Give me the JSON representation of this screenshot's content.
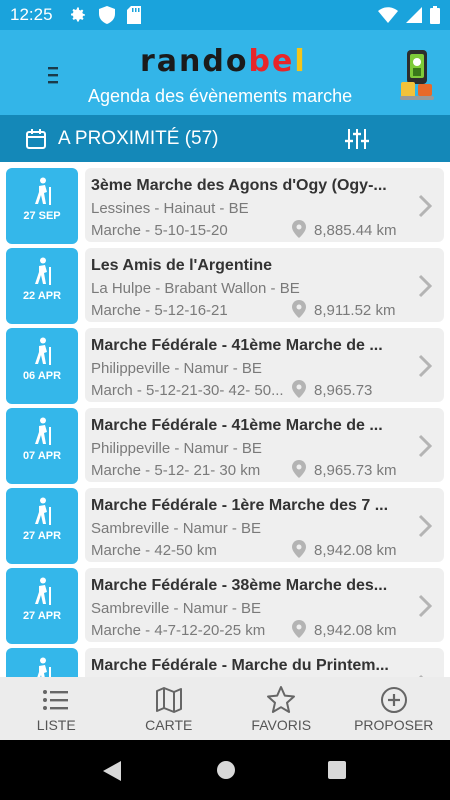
{
  "status_bar": {
    "time": "12:25"
  },
  "header": {
    "logo": {
      "part1": "rando",
      "part2": "be",
      "part3": "l"
    },
    "subtitle": "Agenda des évènements marche"
  },
  "nearby": {
    "title": "A PROXIMITÉ (57)"
  },
  "events": [
    {
      "day": "27 SEP",
      "title": "3ème Marche des Agons d'Ogy (Ogy-...",
      "location": "Lessines - Hainaut - BE",
      "distances": "Marche - 5-10-15-20",
      "km": "8,885.44 km"
    },
    {
      "day": "22 APR",
      "title": "Les Amis de l'Argentine",
      "location": "La Hulpe - Brabant Wallon - BE",
      "distances": "Marche - 5-12-16-21",
      "km": "8,911.52 km"
    },
    {
      "day": "06 APR",
      "title": "Marche Fédérale - 41ème Marche de ...",
      "location": "Philippeville - Namur - BE",
      "distances": "March  - 5-12-21-30- 42- 50...",
      "km": "8,965.73"
    },
    {
      "day": "07 APR",
      "title": "Marche Fédérale - 41ème Marche de ...",
      "location": "Philippeville - Namur - BE",
      "distances": "Marche - 5-12- 21- 30 km",
      "km": "8,965.73 km"
    },
    {
      "day": "27 APR",
      "title": "Marche Fédérale - 1ère Marche des 7 ...",
      "location": "Sambreville - Namur - BE",
      "distances": "Marche - 42-50 km",
      "km": "8,942.08 km"
    },
    {
      "day": "27 APR",
      "title": "Marche Fédérale - 38ème Marche des...",
      "location": "Sambreville - Namur - BE",
      "distances": "Marche - 4-7-12-20-25 km",
      "km": "8,942.08 km"
    },
    {
      "day": "",
      "title": "Marche Fédérale - Marche du Printem...",
      "location": "",
      "distances": "",
      "km": ""
    }
  ],
  "bottom_nav": {
    "liste": "LISTE",
    "carte": "CARTE",
    "favoris": "FAVORIS",
    "proposer": "PROPOSER"
  },
  "colors": {
    "status_bar": "#1aa3dc",
    "header": "#33b5e8",
    "nearby_bar": "#1488b8",
    "date_badge": "#34b7ea",
    "card": "#efefef"
  }
}
